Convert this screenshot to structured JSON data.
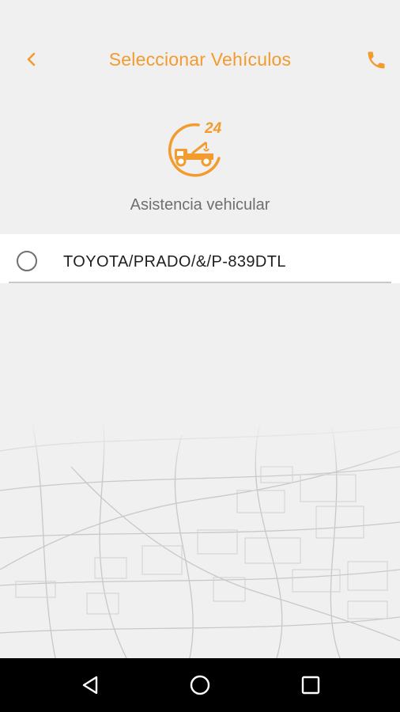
{
  "header": {
    "title": "Seleccionar Vehículos",
    "back_icon": "chevron-left-icon",
    "call_icon": "phone-icon"
  },
  "logo": {
    "badge_number": "24",
    "icon": "tow-truck-icon"
  },
  "service": {
    "name": "Asistencia vehicular"
  },
  "vehicles": [
    {
      "label": "TOYOTA/PRADO/&/P-839DTL",
      "selected": false
    }
  ],
  "colors": {
    "accent": "#f29b2e",
    "background": "#f0f0f0",
    "navbar": "#000000"
  },
  "navbar": {
    "icons": [
      "back-triangle-icon",
      "home-circle-icon",
      "recents-square-icon"
    ]
  }
}
